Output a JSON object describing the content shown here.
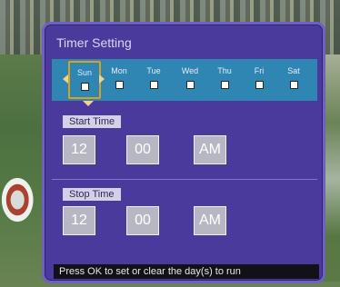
{
  "dialog": {
    "title": "Timer Setting",
    "days": [
      {
        "label": "Sun",
        "selected": true
      },
      {
        "label": "Mon",
        "selected": false
      },
      {
        "label": "Tue",
        "selected": false
      },
      {
        "label": "Wed",
        "selected": false
      },
      {
        "label": "Thu",
        "selected": false
      },
      {
        "label": "Fri",
        "selected": false
      },
      {
        "label": "Sat",
        "selected": false
      }
    ],
    "start": {
      "label": "Start Time",
      "hour": "12",
      "minute": "00",
      "ampm": "AM"
    },
    "stop": {
      "label": "Stop Time",
      "hour": "12",
      "minute": "00",
      "ampm": "AM"
    },
    "status": "Press OK to set or clear the day(s) to run"
  },
  "colors": {
    "panel": "#4a3a9c",
    "day_bar": "#2f86b3",
    "selection": "#d8a21e",
    "time_box": "#b7b7c4"
  },
  "icons": [
    "left-arrow-icon",
    "right-arrow-icon",
    "down-arrow-icon"
  ]
}
